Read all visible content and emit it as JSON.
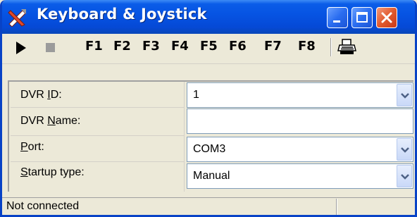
{
  "window": {
    "title": "Keyboard & Joystick",
    "accent": "#0a5ce8",
    "close_color": "#e25a2e"
  },
  "toolbar": {
    "play_icon": "play-icon",
    "stop_icon": "stop-icon",
    "print_icon": "printer-icon",
    "function_keys": [
      "F1",
      "F2",
      "F3",
      "F4",
      "F5",
      "F6",
      "F7",
      "F8"
    ]
  },
  "form": {
    "rows": [
      {
        "label_pre": "DVR ",
        "label_access": "I",
        "label_post": "D:",
        "value": "1",
        "type": "dropdown"
      },
      {
        "label_pre": "DVR ",
        "label_access": "N",
        "label_post": "ame:",
        "value": "",
        "type": "text"
      },
      {
        "label_pre": "",
        "label_access": "P",
        "label_post": "ort:",
        "value": "COM3",
        "type": "dropdown"
      },
      {
        "label_pre": "",
        "label_access": "S",
        "label_post": "tartup type:",
        "value": "Manual",
        "type": "dropdown"
      }
    ]
  },
  "statusbar": {
    "text": "Not connected"
  }
}
